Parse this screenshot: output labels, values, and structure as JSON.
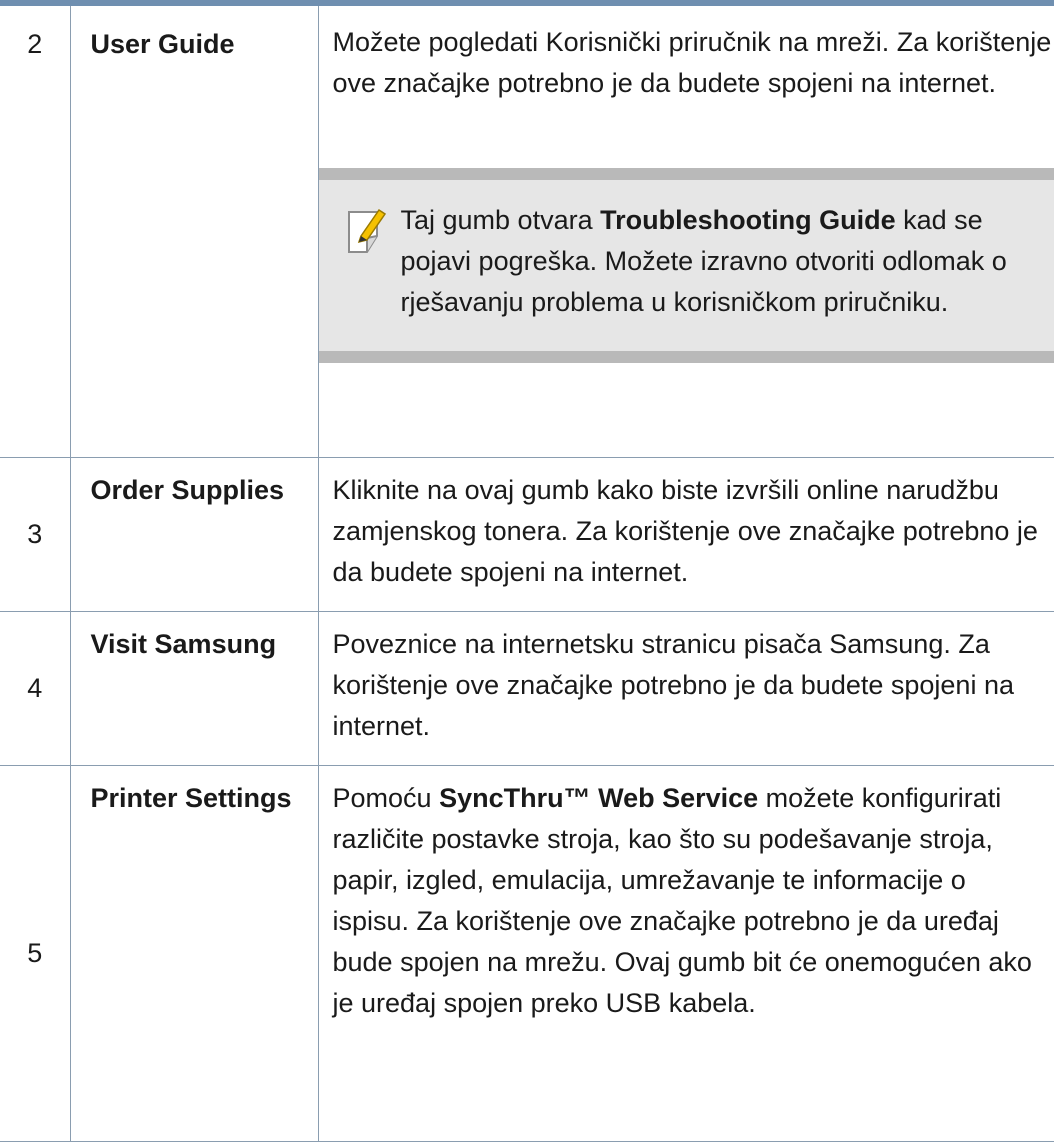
{
  "rows": [
    {
      "num": "2",
      "name": "User Guide",
      "desc": "Možete pogledati Korisnički priručnik na mreži. Za korištenje ove značajke potrebno je da budete spojeni na internet.",
      "note": {
        "icon": "note-pencil-icon",
        "text_before": "Taj gumb otvara ",
        "bold": "Troubleshooting Guide",
        "text_after": " kad se pojavi pogreška. Možete izravno otvoriti odlomak o rješavanju problema u korisničkom priručniku."
      }
    },
    {
      "num": "3",
      "name": "Order Supplies",
      "desc": "Kliknite na ovaj gumb kako biste izvršili online narudžbu zamjenskog tonera. Za korištenje ove značajke potrebno je da budete spojeni na internet."
    },
    {
      "num": "4",
      "name": "Visit Samsung",
      "desc": "Poveznice na internetsku stranicu pisača Samsung. Za korištenje ove značajke potrebno je da budete spojeni na internet."
    },
    {
      "num": "5",
      "name": "Printer Settings",
      "desc_before": "Pomoću ",
      "desc_bold": "SyncThru™ Web Service",
      "desc_after": " možete konfigurirati različite postavke stroja, kao što su podešavanje stroja, papir, izgled, emulacija, umrežavanje te informacije o ispisu. Za korištenje ove značajke potrebno je da uređaj bude spojen na mrežu. Ovaj gumb bit će onemogućen ako je uređaj spojen preko USB kabela."
    }
  ],
  "colors": {
    "header_bar": "#6f8fb0",
    "rule": "#8a9db0",
    "note_bg": "#e6e6e6",
    "note_bar": "#b9b9b9"
  }
}
